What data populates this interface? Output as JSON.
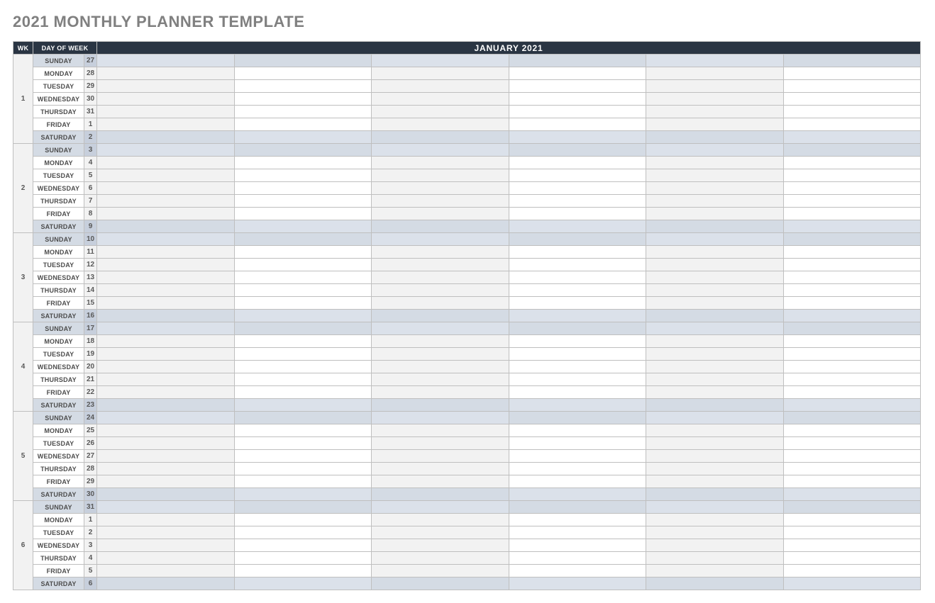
{
  "title": "2021 MONTHLY PLANNER TEMPLATE",
  "header": {
    "wk": "WK",
    "day_of_week": "DAY OF WEEK",
    "month": "JANUARY 2021"
  },
  "entry_columns": 6,
  "weeks": [
    {
      "num": "1",
      "days": [
        {
          "dow": "SUNDAY",
          "date": "27",
          "weekend": true
        },
        {
          "dow": "MONDAY",
          "date": "28",
          "weekend": false
        },
        {
          "dow": "TUESDAY",
          "date": "29",
          "weekend": false
        },
        {
          "dow": "WEDNESDAY",
          "date": "30",
          "weekend": false
        },
        {
          "dow": "THURSDAY",
          "date": "31",
          "weekend": false
        },
        {
          "dow": "FRIDAY",
          "date": "1",
          "weekend": false
        },
        {
          "dow": "SATURDAY",
          "date": "2",
          "weekend": true
        }
      ]
    },
    {
      "num": "2",
      "days": [
        {
          "dow": "SUNDAY",
          "date": "3",
          "weekend": true
        },
        {
          "dow": "MONDAY",
          "date": "4",
          "weekend": false
        },
        {
          "dow": "TUESDAY",
          "date": "5",
          "weekend": false
        },
        {
          "dow": "WEDNESDAY",
          "date": "6",
          "weekend": false
        },
        {
          "dow": "THURSDAY",
          "date": "7",
          "weekend": false
        },
        {
          "dow": "FRIDAY",
          "date": "8",
          "weekend": false
        },
        {
          "dow": "SATURDAY",
          "date": "9",
          "weekend": true
        }
      ]
    },
    {
      "num": "3",
      "days": [
        {
          "dow": "SUNDAY",
          "date": "10",
          "weekend": true
        },
        {
          "dow": "MONDAY",
          "date": "11",
          "weekend": false
        },
        {
          "dow": "TUESDAY",
          "date": "12",
          "weekend": false
        },
        {
          "dow": "WEDNESDAY",
          "date": "13",
          "weekend": false
        },
        {
          "dow": "THURSDAY",
          "date": "14",
          "weekend": false
        },
        {
          "dow": "FRIDAY",
          "date": "15",
          "weekend": false
        },
        {
          "dow": "SATURDAY",
          "date": "16",
          "weekend": true
        }
      ]
    },
    {
      "num": "4",
      "days": [
        {
          "dow": "SUNDAY",
          "date": "17",
          "weekend": true
        },
        {
          "dow": "MONDAY",
          "date": "18",
          "weekend": false
        },
        {
          "dow": "TUESDAY",
          "date": "19",
          "weekend": false
        },
        {
          "dow": "WEDNESDAY",
          "date": "20",
          "weekend": false
        },
        {
          "dow": "THURSDAY",
          "date": "21",
          "weekend": false
        },
        {
          "dow": "FRIDAY",
          "date": "22",
          "weekend": false
        },
        {
          "dow": "SATURDAY",
          "date": "23",
          "weekend": true
        }
      ]
    },
    {
      "num": "5",
      "days": [
        {
          "dow": "SUNDAY",
          "date": "24",
          "weekend": true
        },
        {
          "dow": "MONDAY",
          "date": "25",
          "weekend": false
        },
        {
          "dow": "TUESDAY",
          "date": "26",
          "weekend": false
        },
        {
          "dow": "WEDNESDAY",
          "date": "27",
          "weekend": false
        },
        {
          "dow": "THURSDAY",
          "date": "28",
          "weekend": false
        },
        {
          "dow": "FRIDAY",
          "date": "29",
          "weekend": false
        },
        {
          "dow": "SATURDAY",
          "date": "30",
          "weekend": true
        }
      ]
    },
    {
      "num": "6",
      "days": [
        {
          "dow": "SUNDAY",
          "date": "31",
          "weekend": true
        },
        {
          "dow": "MONDAY",
          "date": "1",
          "weekend": false
        },
        {
          "dow": "TUESDAY",
          "date": "2",
          "weekend": false
        },
        {
          "dow": "WEDNESDAY",
          "date": "3",
          "weekend": false
        },
        {
          "dow": "THURSDAY",
          "date": "4",
          "weekend": false
        },
        {
          "dow": "FRIDAY",
          "date": "5",
          "weekend": false
        },
        {
          "dow": "SATURDAY",
          "date": "6",
          "weekend": true
        }
      ]
    }
  ]
}
